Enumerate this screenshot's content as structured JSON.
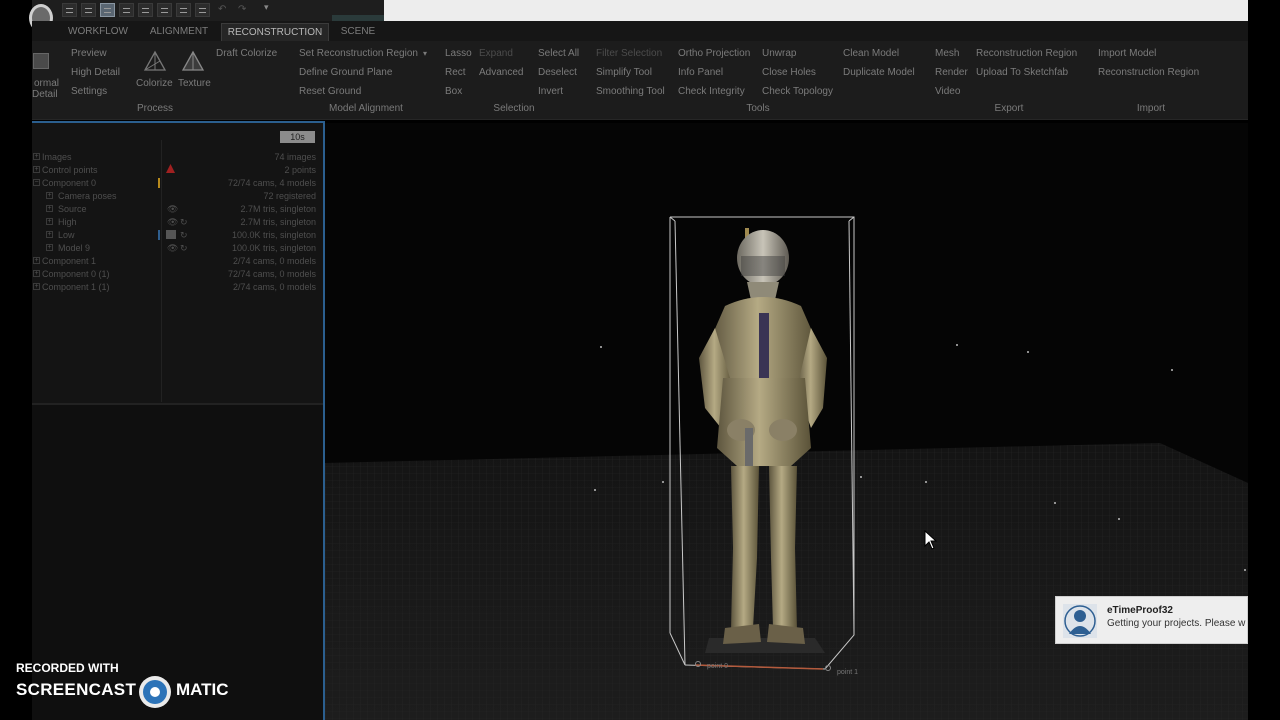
{
  "tabs": [
    "WORKFLOW",
    "ALIGNMENT",
    "RECONSTRUCTION",
    "SCENE"
  ],
  "ribbon": {
    "process": {
      "normal_line1": "ormal",
      "normal_line2": "Detail",
      "preview": "Preview",
      "high_detail": "High Detail",
      "settings": "Settings",
      "colorize": "Colorize",
      "texture": "Texture",
      "draft_colorize": "Draft Colorize"
    },
    "model_alignment": {
      "set_region": "Set Reconstruction Region",
      "define_ground": "Define Ground Plane",
      "reset_ground": "Reset Ground"
    },
    "selection": {
      "lasso": "Lasso",
      "rect": "Rect",
      "box": "Box",
      "expand": "Expand",
      "advanced": "Advanced",
      "select_all": "Select All",
      "deselect": "Deselect",
      "invert": "Invert"
    },
    "tools": {
      "filter_selection": "Filter Selection",
      "simplify": "Simplify Tool",
      "smoothing": "Smoothing Tool",
      "ortho": "Ortho Projection",
      "info_panel": "Info Panel",
      "check_integrity": "Check Integrity",
      "unwrap": "Unwrap",
      "close_holes": "Close Holes",
      "check_topology": "Check Topology",
      "clean_model": "Clean Model",
      "duplicate_model": "Duplicate Model"
    },
    "export": {
      "mesh": "Mesh",
      "render": "Render",
      "video": "Video",
      "reconstruction_region": "Reconstruction Region",
      "upload": "Upload To Sketchfab"
    },
    "import": {
      "import_model": "Import Model",
      "reconstruction_region": "Reconstruction Region"
    },
    "groups": [
      "Process",
      "Model Alignment",
      "Selection",
      "Tools",
      "Export",
      "Import"
    ]
  },
  "panel": {
    "timer_button": "10s",
    "rows": [
      {
        "label": "Images",
        "value": "74 images"
      },
      {
        "label": "Control points",
        "value": "2 points"
      },
      {
        "label": "Component 0",
        "value": "72/74 cams, 4 models"
      },
      {
        "label": "Camera poses",
        "value": "72 registered"
      },
      {
        "label": "Source",
        "value": "2.7M tris, singleton"
      },
      {
        "label": "High",
        "value": "2.7M tris, singleton"
      },
      {
        "label": "Low",
        "value": "100.0K tris, singleton"
      },
      {
        "label": "Model 9",
        "value": "100.0K tris, singleton"
      },
      {
        "label": "Component 1",
        "value": "2/74 cams, 0 models"
      },
      {
        "label": "Component 0 (1)",
        "value": "72/74 cams, 0 models"
      },
      {
        "label": "Component 1 (1)",
        "value": "2/74 cams, 0 models"
      }
    ]
  },
  "viewport": {
    "point0": "point 0",
    "point1": "point 1"
  },
  "toast": {
    "title": "eTimeProof32",
    "message": "Getting your projects. Please w"
  },
  "watermark": {
    "line1": "RECORDED WITH",
    "left": "SCREENCAST",
    "right": "MATIC"
  }
}
